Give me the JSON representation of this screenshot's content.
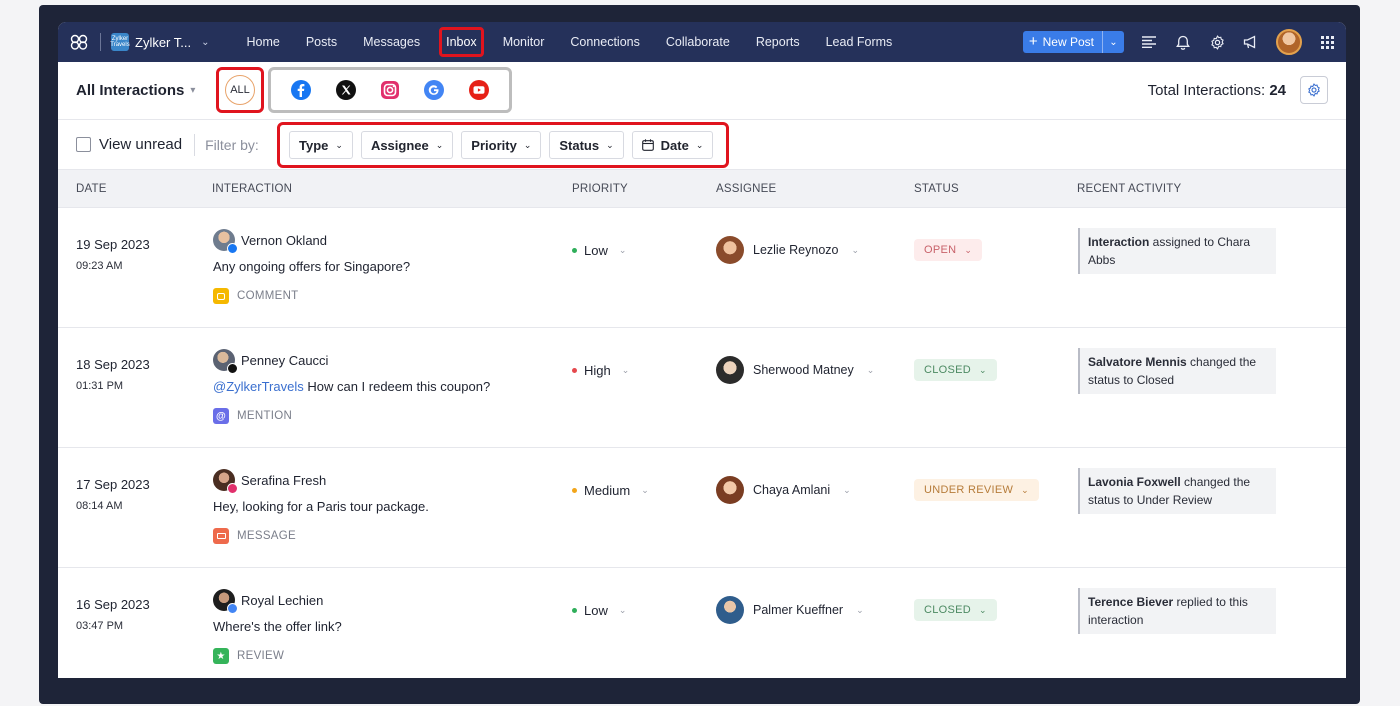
{
  "colors": {
    "nav_bg": "#25315a",
    "highlight_red": "#e0141e",
    "highlight_gray": "#bdbdbd",
    "new_post_bg": "#3a7ce8",
    "status_open_bg": "#fdecec",
    "status_closed_bg": "#e6f3ea",
    "status_review_bg": "#fdf1e3",
    "priority_low": "#2fae5a",
    "priority_high": "#e5484d",
    "priority_medium": "#f2a51a"
  },
  "topnav": {
    "brand": "Zylker T...",
    "brand_logo_text": "Zylker Travels",
    "links": [
      "Home",
      "Posts",
      "Messages",
      "Inbox",
      "Monitor",
      "Connections",
      "Collaborate",
      "Reports",
      "Lead Forms"
    ],
    "active": "Inbox",
    "new_post": "New Post",
    "icons": [
      "list-icon",
      "bell-icon",
      "gear-icon",
      "megaphone-icon",
      "avatar",
      "grid-icon"
    ]
  },
  "subheader": {
    "title": "All Interactions",
    "all_label": "ALL",
    "channels": [
      "facebook-icon",
      "x-icon",
      "instagram-icon",
      "google-icon",
      "youtube-icon"
    ],
    "total_label": "Total Interactions:",
    "total_value": "24"
  },
  "filterbar": {
    "view_unread": "View unread",
    "filter_by": "Filter by:",
    "filters": [
      "Type",
      "Assignee",
      "Priority",
      "Status",
      "Date"
    ]
  },
  "table": {
    "headers": [
      "DATE",
      "INTERACTION",
      "PRIORITY",
      "ASSIGNEE",
      "STATUS",
      "RECENT ACTIVITY"
    ],
    "rows": [
      {
        "date": "19 Sep 2023",
        "time": "09:23 AM",
        "user": "Vernon Okland",
        "channel": "facebook",
        "mention": "",
        "message": "Any ongoing offers for Singapore?",
        "type": "COMMENT",
        "type_color": "#f5b800",
        "priority": "Low",
        "priority_color": "#2fae5a",
        "assignee": "Lezlie Reynozo",
        "status": "OPEN",
        "status_bg": "#fdecec",
        "status_fg": "#c8626a",
        "activity_bold": "Interaction",
        "activity_rest": " assigned to Chara Abbs"
      },
      {
        "date": "18 Sep 2023",
        "time": "01:31 PM",
        "user": "Penney Caucci",
        "channel": "x",
        "mention": "@ZylkerTravels",
        "message": " How can I redeem this coupon?",
        "type": "MENTION",
        "type_color": "#6a6ee8",
        "priority": "High",
        "priority_color": "#e5484d",
        "assignee": "Sherwood Matney",
        "status": "CLOSED",
        "status_bg": "#e6f3ea",
        "status_fg": "#4d8a63",
        "activity_bold": "Salvatore Mennis",
        "activity_rest": " changed the status to Closed"
      },
      {
        "date": "17 Sep 2023",
        "time": "08:14 AM",
        "user": "Serafina Fresh",
        "channel": "instagram",
        "mention": "",
        "message": "Hey, looking for a Paris tour package.",
        "type": "MESSAGE",
        "type_color": "#ee6a4c",
        "priority": "Medium",
        "priority_color": "#f2a51a",
        "assignee": "Chaya Amlani",
        "status": "UNDER REVIEW",
        "status_bg": "#fdf1e3",
        "status_fg": "#b67c3a",
        "activity_bold": "Lavonia Foxwell",
        "activity_rest": " changed the status to Under Review"
      },
      {
        "date": "16 Sep 2023",
        "time": "03:47 PM",
        "user": "Royal Lechien",
        "channel": "google",
        "mention": "",
        "message": "Where's the offer link?",
        "type": "REVIEW",
        "type_color": "#35b45a",
        "priority": "Low",
        "priority_color": "#2fae5a",
        "assignee": "Palmer Kueffner",
        "status": "CLOSED",
        "status_bg": "#e6f3ea",
        "status_fg": "#4d8a63",
        "activity_bold": "Terence Biever",
        "activity_rest": " replied to this interaction"
      }
    ]
  }
}
